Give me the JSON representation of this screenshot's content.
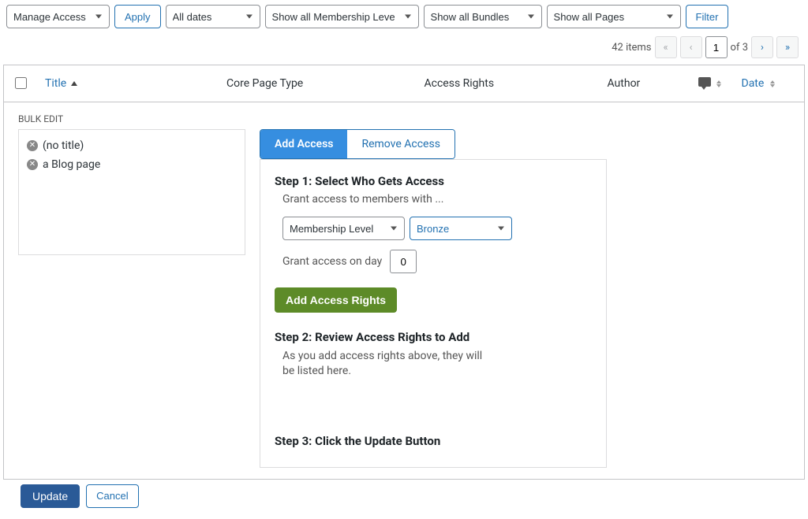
{
  "topbar": {
    "bulk_action": "Manage Access",
    "apply_label": "Apply",
    "filter_date": "All dates",
    "filter_membership": "Show all Membership Leve",
    "filter_bundles": "Show all Bundles",
    "filter_pages": "Show all Pages",
    "filter_button": "Filter"
  },
  "pagination": {
    "count_label": "42 items",
    "current_page": "1",
    "total_pages": "3"
  },
  "columns": {
    "title": "Title",
    "core_page_type": "Core Page Type",
    "access_rights": "Access Rights",
    "author": "Author",
    "date": "Date"
  },
  "bulk_edit": {
    "heading": "BULK EDIT",
    "items": [
      "(no title)",
      "a Blog page"
    ]
  },
  "tabs": {
    "add_access": "Add Access",
    "remove_access": "Remove Access"
  },
  "step1": {
    "heading": "Step 1: Select Who Gets Access",
    "sub": "Grant access to members with ...",
    "type_selector": "Membership Level",
    "level_selector": "Bronze",
    "day_label": "Grant access on day",
    "day_value": "0",
    "add_button": "Add Access Rights"
  },
  "step2": {
    "heading": "Step 2: Review Access Rights to Add",
    "desc": "As you add access rights above, they will be listed here."
  },
  "step3": {
    "heading": "Step 3: Click the Update Button"
  },
  "actions": {
    "update": "Update",
    "cancel": "Cancel"
  }
}
